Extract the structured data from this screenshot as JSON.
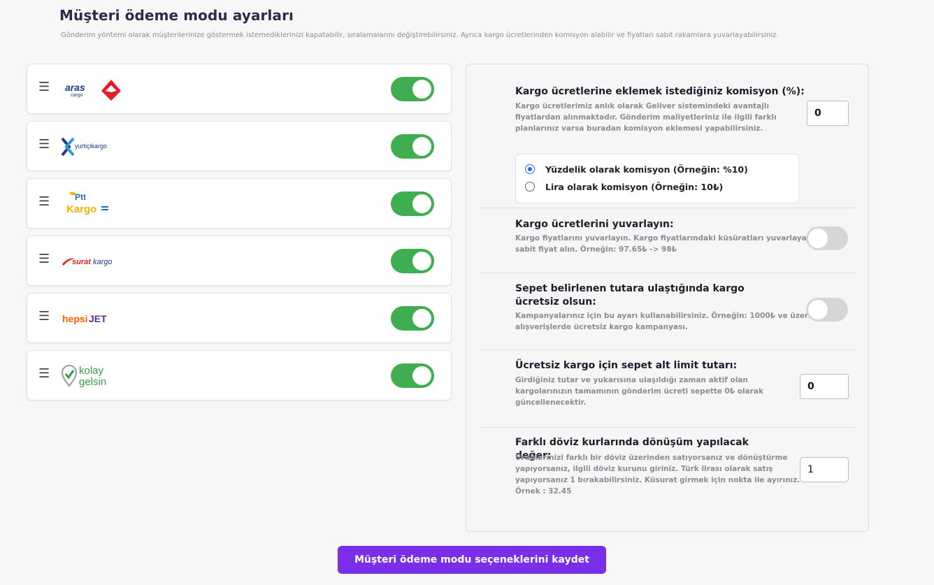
{
  "header": {
    "title": "Müşteri ödeme modu ayarları",
    "subtitle": "Gönderim yöntemi olarak müşterilerinize göstermek istemediklerinizi kapatabilir, sıralamalarını değiştirebilirsiniz. Ayrıca kargo ücretlerinden komisyon alabilir ve fiyatları sabit rakamlara yuvarlayabilirsiniz."
  },
  "carriers": [
    {
      "name": "aras kargo",
      "enabled": true
    },
    {
      "name": "yurtiçikargo",
      "enabled": true
    },
    {
      "name": "Ptt Kargo",
      "enabled": true
    },
    {
      "name": "suratkargo",
      "enabled": true
    },
    {
      "name": "hepsiJET",
      "enabled": true
    },
    {
      "name": "kolay gelsin",
      "enabled": true
    }
  ],
  "logos": {
    "aras": {
      "word": "aras",
      "sub": "cargo"
    },
    "yurtici": {
      "word": "yurtiçikargo"
    },
    "ptt": {
      "top": "Ptt",
      "bottom": "Kargo"
    },
    "surat": {
      "word1": "surat",
      "word2": "kargo"
    },
    "hepsi": {
      "word1": "hepsi",
      "word2": "JET"
    },
    "kolay": {
      "line1": "kolay",
      "line2": "gelsin"
    }
  },
  "settings": {
    "commission": {
      "title": "Kargo ücretlerine eklemek istediğiniz komisyon (%):",
      "desc_lines": [
        "Kargo ücretlerimiz anlık olarak Geliver sistemindeki avantajlı",
        "fiyatlardan alınmaktadır. Gönderim maliyetleriniz ile ilgili farklı",
        "planlarınız varsa buradan komisyon eklemesi yapabilirsiniz."
      ],
      "value": "0",
      "options": [
        {
          "label": "Yüzdelik olarak komisyon (Örneğin: %10)",
          "checked": true
        },
        {
          "label": "Lira olarak komisyon (Örneğin: 10₺)",
          "checked": false
        }
      ]
    },
    "rounding": {
      "title": "Kargo ücretlerini yuvarlayın:",
      "desc_lines": [
        "Kargo fiyatlarını yuvarlayın. Kargo fiyatlarındaki küsüratları yuvarlayarak",
        "sabit fiyat alın. Örneğin: 97.65₺ -> 98₺"
      ],
      "enabled": false
    },
    "free_shipping": {
      "title": "Sepet belirlenen tutara ulaştığında kargo ücretsiz olsun:",
      "desc_lines": [
        "Kampanyalarınız için bu ayarı kullanabilirsiniz. Örneğin: 1000₺ ve üzeri",
        "alışverişlerde ücretsiz kargo kampanyası."
      ],
      "enabled": false
    },
    "free_limit": {
      "title": "Ücretsiz kargo için sepet alt limit tutarı:",
      "desc_lines": [
        "Girdiğiniz tutar ve yukarısına ulaşıldığı zaman aktif olan",
        "kargolarınızın tamamının gönderim ücreti sepette 0₺ olarak",
        "güncellenecektir."
      ],
      "value": "0"
    },
    "currency": {
      "title": "Farklı döviz kurlarında dönüşüm yapılacak değer:",
      "desc_lines": [
        "Ürünlerinizi farklı bir döviz üzerinden satıyorsanız ve dönüştürme",
        "yapıyorsanız, ilgili döviz kurunu giriniz. Türk lirası olarak satış",
        "yapıyorsanız 1 bırakabilirsiniz. Küsurat girmek için nokta ile ayırınız.",
        "Örnek : 32.45"
      ],
      "value": "1"
    }
  },
  "save_label": "Müşteri ödeme modu seçeneklerini kaydet",
  "colors": {
    "toggle_on": "#3fae50",
    "toggle_off": "#d6d6d6",
    "primary": "#7a2ee8",
    "radio": "#1a73e8"
  }
}
